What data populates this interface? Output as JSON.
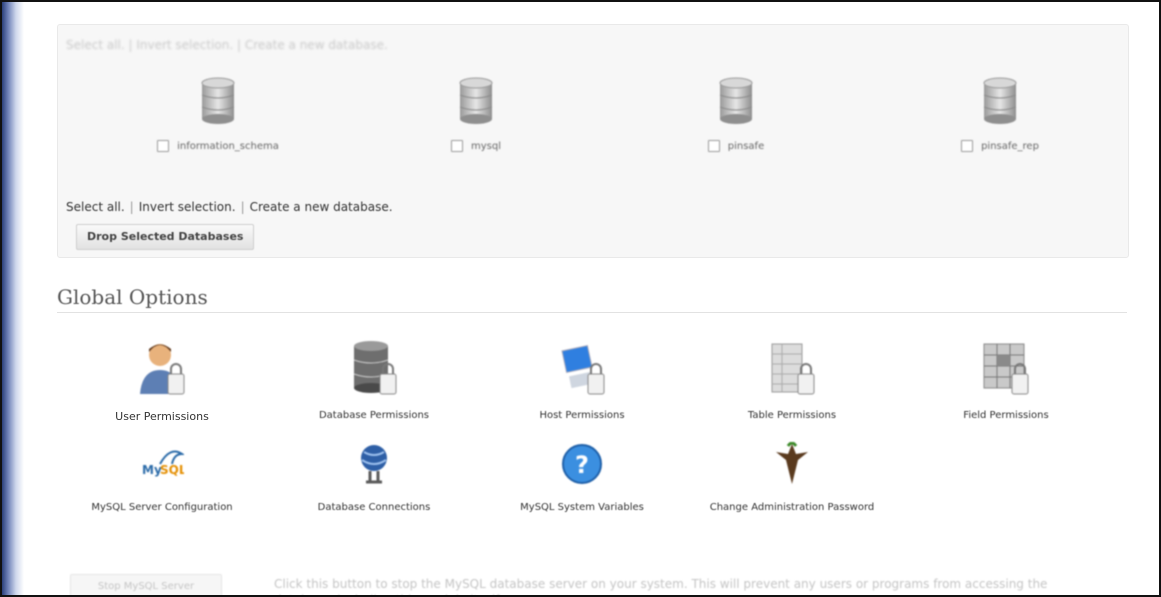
{
  "databases": {
    "top_links": "Select all. | Invert selection. | Create a new database.",
    "items": [
      {
        "name": "information_schema"
      },
      {
        "name": "mysql"
      },
      {
        "name": "pinsafe"
      },
      {
        "name": "pinsafe_rep"
      }
    ],
    "links": {
      "select_all": "Select all.",
      "separator": "|",
      "invert_selection": "Invert selection.",
      "create_new": "Create a new database."
    },
    "drop_button": "Drop Selected Databases"
  },
  "global_options": {
    "title": "Global Options",
    "items": [
      {
        "label": "User Permissions",
        "icon": "user-permissions-icon"
      },
      {
        "label": "Database Permissions",
        "icon": "database-permissions-icon"
      },
      {
        "label": "Host Permissions",
        "icon": "host-permissions-icon"
      },
      {
        "label": "Table Permissions",
        "icon": "table-permissions-icon"
      },
      {
        "label": "Field Permissions",
        "icon": "field-permissions-icon"
      },
      {
        "label": "MySQL Server Configuration",
        "icon": "mysql-logo-icon"
      },
      {
        "label": "Database Connections",
        "icon": "database-connections-icon"
      },
      {
        "label": "MySQL System Variables",
        "icon": "help-question-icon"
      },
      {
        "label": "Change Administration Password",
        "icon": "tree-root-icon"
      }
    ]
  },
  "stop_server": {
    "button": "Stop MySQL Server",
    "description": "Click this button to stop the MySQL database server on your system. This will prevent any users or programs from accessing the database, including this module itself."
  }
}
